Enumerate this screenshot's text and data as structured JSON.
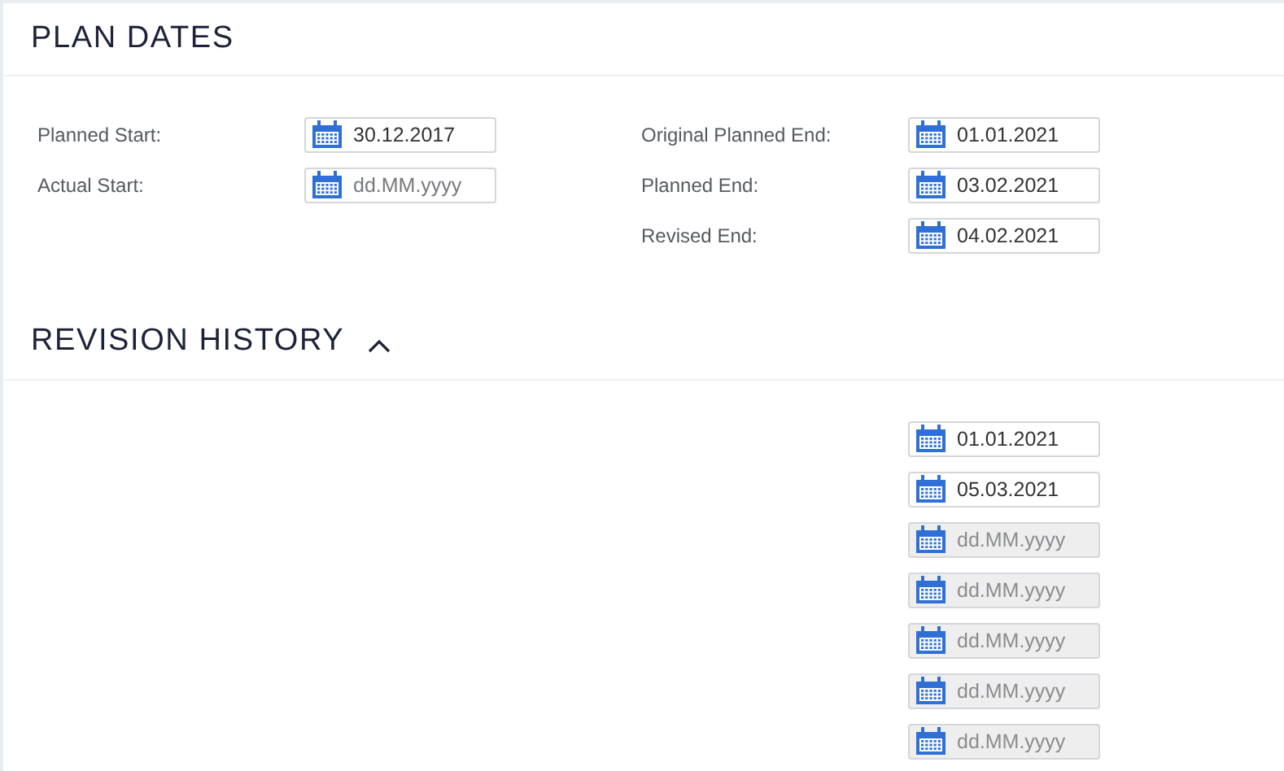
{
  "plan_dates": {
    "title": "PLAN DATES",
    "left_fields": [
      {
        "label": "Planned Start:",
        "value": "30.12.2017",
        "disabled": false
      },
      {
        "label": "Actual Start:",
        "placeholder": "dd.MM.yyyy",
        "disabled": false
      }
    ],
    "right_fields": [
      {
        "label": "Original Planned End:",
        "value": "01.01.2021",
        "disabled": false
      },
      {
        "label": "Planned End:",
        "value": "03.02.2021",
        "disabled": false
      },
      {
        "label": "Revised End:",
        "value": "04.02.2021",
        "disabled": false
      }
    ]
  },
  "revision_history": {
    "title": "REVISION HISTORY",
    "expanded": true,
    "fields": [
      {
        "value": "01.01.2021",
        "disabled": false
      },
      {
        "value": "05.03.2021",
        "disabled": false
      },
      {
        "placeholder": "dd.MM.yyyy",
        "disabled": true
      },
      {
        "placeholder": "dd.MM.yyyy",
        "disabled": true
      },
      {
        "placeholder": "dd.MM.yyyy",
        "disabled": true
      },
      {
        "placeholder": "dd.MM.yyyy",
        "disabled": true
      },
      {
        "placeholder": "dd.MM.yyyy",
        "disabled": true
      }
    ]
  }
}
